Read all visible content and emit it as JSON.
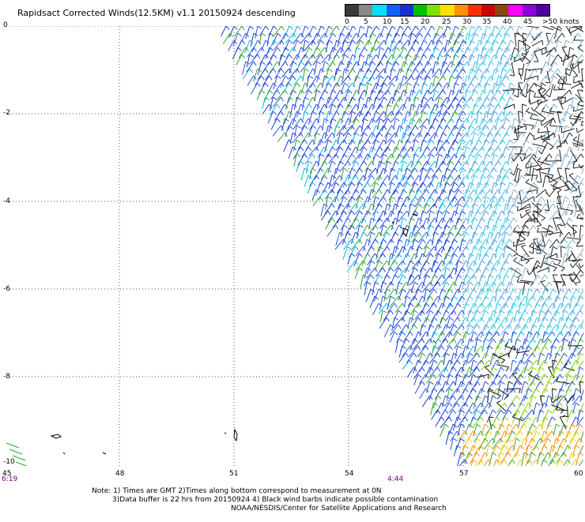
{
  "title": "Rapidsact Corrected Winds(12.5KM) v1.1 20150924 descending",
  "legend": {
    "labels": [
      "0",
      "5",
      "10",
      "15",
      "20",
      "25",
      "30",
      "35",
      "40",
      "45",
      ">50 knots"
    ],
    "colors": [
      "#3a3a3a",
      "#8a8a8a",
      "#00e0ff",
      "#1060ff",
      "#1830d0",
      "#00c000",
      "#80e000",
      "#ffe000",
      "#ff9000",
      "#ff3000",
      "#d00000",
      "#8b4513",
      "#ff00ff",
      "#9000e0",
      "#5000a0"
    ]
  },
  "axes": {
    "y_labels": [
      "0",
      "-2",
      "-4",
      "-6",
      "-8",
      "-10"
    ],
    "x_labels": [
      "45",
      "48",
      "51",
      "54",
      "57",
      "60"
    ],
    "times": [
      "6:19",
      "4:44"
    ]
  },
  "notes": {
    "line1": "Note: 1) Times are GMT 2)Times along bottom correspond to measurement at 0N",
    "line2": "3)Data buffer is 22 hrs from 20150924 4) Black wind barbs indicate possible contamination",
    "line3": "NOAA/NESDIS/Center for Satellite Applications and Research"
  }
}
